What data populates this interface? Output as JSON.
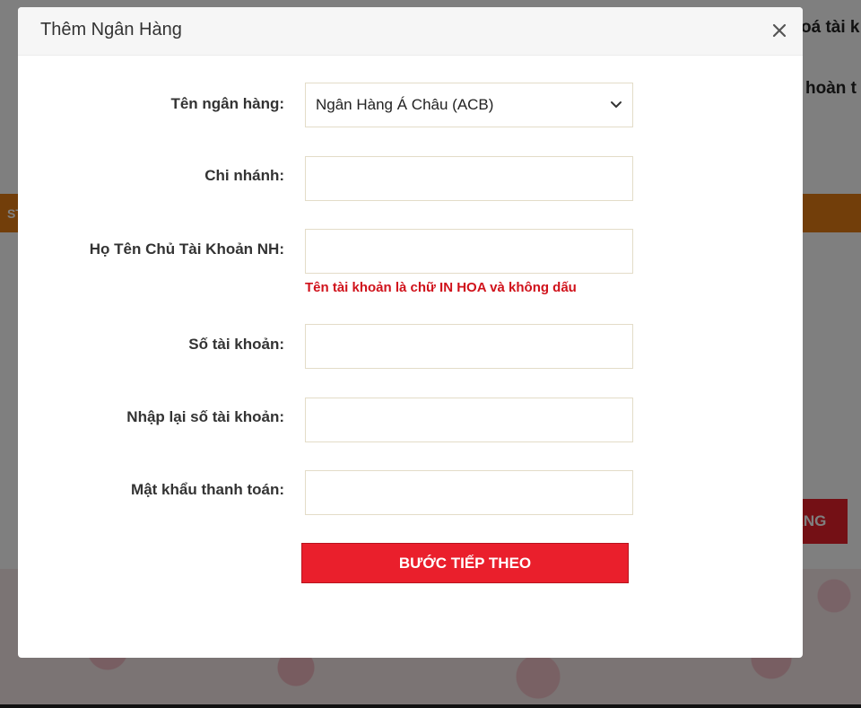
{
  "background": {
    "top_text_1": "oá tài k",
    "top_text_2": "hoàn t",
    "orange_bar_text": "ST",
    "red_button_label": "ÀNG"
  },
  "modal": {
    "title": "Thêm Ngân Hàng",
    "close_icon": "close-icon",
    "fields": {
      "bank_name": {
        "label": "Tên ngân hàng:",
        "selected": "Ngân Hàng Á Châu (ACB)"
      },
      "branch": {
        "label": "Chi nhánh:",
        "value": ""
      },
      "account_holder": {
        "label": "Họ Tên Chủ Tài Khoản NH:",
        "value": "",
        "hint": "Tên tài khoản là chữ IN HOA và không dấu"
      },
      "account_number": {
        "label": "Số tài khoản:",
        "value": ""
      },
      "confirm_account_number": {
        "label": "Nhập lại số tài khoản:",
        "value": ""
      },
      "payment_password": {
        "label": "Mật khẩu thanh toán:",
        "value": ""
      }
    },
    "submit_label": "BƯỚC TIẾP THEO"
  },
  "colors": {
    "accent_red": "#ea1f2c",
    "hint_red": "#d0121b",
    "orange_bar": "#e47c14",
    "input_border": "#e3dcc8"
  }
}
